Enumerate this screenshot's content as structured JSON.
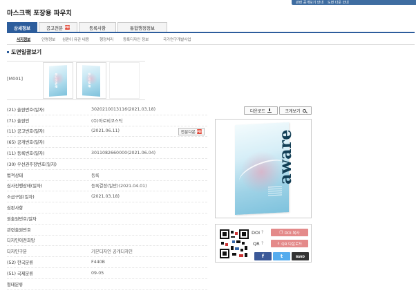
{
  "topbar": {
    "items": [
      "관련 공개보기 안내",
      "도면 다운 안내"
    ]
  },
  "page_title": "마스크팩 포장용 파우치",
  "tabs": [
    {
      "label": "상세정보"
    },
    {
      "label": "공고전문"
    },
    {
      "label": "등록사항"
    },
    {
      "label": "통합행정정보"
    }
  ],
  "subtabs": [
    "서지정보",
    "인명정보",
    "심판이 유관 내용",
    "행정처리",
    "등록디자인 정보",
    "국가연구개발사업"
  ],
  "section_title": "도면일괄보기",
  "thumbnails": {
    "label": "[M001]",
    "word": "aware"
  },
  "buttons": {
    "download": "다운로드",
    "view_large": "크게보기",
    "full_text_download": "전문다운"
  },
  "info_rows": [
    {
      "label": "(21) 출원번호(일자)",
      "value": "3020210013116(2021.03.18)"
    },
    {
      "label": "(71) 출원인",
      "value": "(주)아로비코스틱"
    },
    {
      "label": "(11) 공고번호(일자)",
      "value": "(2021.06.11)"
    },
    {
      "label": "(65) 공개번호(일자)",
      "value": ""
    },
    {
      "label": "(11) 등록번호(일자)",
      "value": "3011082660000(2021.06.04)"
    },
    {
      "label": "(30) 우선권주장번호(일자)",
      "value": ""
    },
    {
      "label": "법적상태",
      "value": "등록"
    },
    {
      "label": "심사진행상태(일자)",
      "value": "등록결정(일반)(2021.04.01)"
    },
    {
      "label": "소급구분(일자)",
      "value": "(2021.03.18)"
    },
    {
      "label": "심판사항",
      "value": ""
    },
    {
      "label": "원출원번호/일자",
      "value": ""
    },
    {
      "label": "관련출원번호",
      "value": ""
    },
    {
      "label": "디자인이전희망",
      "value": ""
    },
    {
      "label": "디자인구분",
      "value": "기본디자인 공개디자인"
    },
    {
      "label": "(52) 한국분류",
      "value": "F440B"
    },
    {
      "label": "(51) 국제분류",
      "value": "09-05"
    },
    {
      "label": "형태분류",
      "value": ""
    }
  ],
  "preview": {
    "word": "aware"
  },
  "share": {
    "doi_label": "DOI",
    "qr_label": "QR",
    "doi_copy": "DOI 복사",
    "qr_download": "QR 다운로드",
    "facebook": "f",
    "twitter": "t",
    "band": "BAND"
  },
  "colors": {
    "primary": "#2d5d9c",
    "share_button": "#e48a8a",
    "facebook": "#3b5998",
    "twitter": "#55acee",
    "band": "#333333"
  }
}
